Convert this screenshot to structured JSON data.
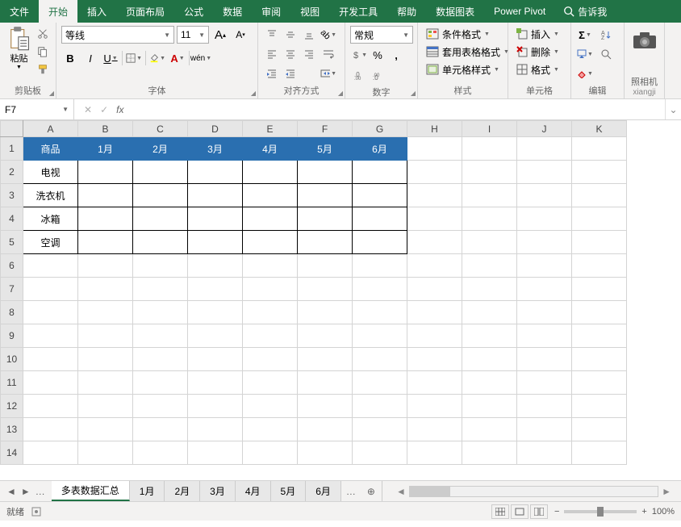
{
  "menu": {
    "tabs": [
      "文件",
      "开始",
      "插入",
      "页面布局",
      "公式",
      "数据",
      "审阅",
      "视图",
      "开发工具",
      "帮助",
      "数据图表",
      "Power Pivot"
    ],
    "active": 1,
    "tellme": "告诉我"
  },
  "ribbon": {
    "clipboard": {
      "label": "剪贴板",
      "paste": "粘贴"
    },
    "font": {
      "label": "字体",
      "name": "等线",
      "size": "11",
      "bold": "B",
      "italic": "I",
      "underline": "U",
      "increase": "A",
      "decrease": "A",
      "wen": "wén"
    },
    "align": {
      "label": "对齐方式",
      "wrap": "ab"
    },
    "number": {
      "label": "数字",
      "format": "常规",
      "percent": "%",
      "comma": ","
    },
    "styles": {
      "label": "样式",
      "cond": "条件格式",
      "table": "套用表格格式",
      "cell": "单元格样式"
    },
    "cells": {
      "label": "单元格",
      "insert": "插入",
      "delete": "删除",
      "format": "格式"
    },
    "editing": {
      "label": "编辑",
      "sigma": "Σ"
    },
    "camera": {
      "label": "照相机",
      "sub": "xiangji"
    }
  },
  "namebox": {
    "ref": "F7"
  },
  "grid": {
    "cols": [
      "A",
      "B",
      "C",
      "D",
      "E",
      "F",
      "G",
      "H",
      "I",
      "J",
      "K"
    ],
    "header": [
      "商品",
      "1月",
      "2月",
      "3月",
      "4月",
      "5月",
      "6月"
    ],
    "rows": [
      "电视",
      "洗衣机",
      "冰箱",
      "空调"
    ],
    "rowcount": 14
  },
  "sheets": {
    "active": 0,
    "list": [
      "多表数据汇总",
      "1月",
      "2月",
      "3月",
      "4月",
      "5月",
      "6月"
    ]
  },
  "status": {
    "ready": "就绪",
    "zoom": "100%"
  }
}
